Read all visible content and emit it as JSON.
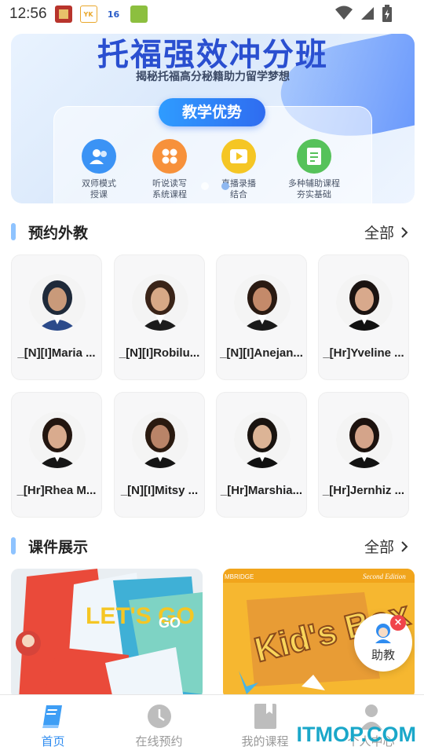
{
  "status_bar": {
    "time": "12:56",
    "app_icons": [
      {
        "name": "app-icon-1",
        "color": "#b8342c"
      },
      {
        "name": "app-icon-yk",
        "color": "#e9a72c",
        "text": "YK"
      },
      {
        "name": "app-icon-16",
        "color": "#2a5cc8",
        "text": "16"
      },
      {
        "name": "app-icon-4",
        "color": "#8cbf3f"
      }
    ]
  },
  "banner": {
    "title": "托福强效冲分班",
    "subtitle": "揭秘托福高分秘籍助力留学梦想",
    "pill": "教学优势",
    "features": [
      {
        "label": "双师模式\n授课",
        "icon": "users-icon",
        "color": "#3b93f5"
      },
      {
        "label": "听说读写\n系统课程",
        "icon": "grid-icon",
        "color": "#f7913b"
      },
      {
        "label": "直播录播\n结合",
        "icon": "play-icon",
        "color": "#f5c624"
      },
      {
        "label": "多种辅助课程\n夯实基础",
        "icon": "document-icon",
        "color": "#56c25a"
      }
    ]
  },
  "teachers_section": {
    "title": "预约外教",
    "more": "全部",
    "teachers": [
      {
        "name": "_[N][I]Maria ..."
      },
      {
        "name": "_[N][I]Robilu..."
      },
      {
        "name": "_[N][I]Anejan..."
      },
      {
        "name": "_[Hr]Yveline ..."
      },
      {
        "name": "_[Hr]Rhea M..."
      },
      {
        "name": "_[N][I]Mitsy ..."
      },
      {
        "name": "_[Hr]Marshia..."
      },
      {
        "name": "_[Hr]Jernhiz ..."
      }
    ]
  },
  "courseware_section": {
    "title": "课件展示",
    "more": "全部",
    "items": [
      {
        "title": "LET'S GO"
      },
      {
        "title": "Kid's Box",
        "edition": "Second Edition",
        "publisher": "MBRIDGE"
      }
    ]
  },
  "assistant": {
    "label": "助教",
    "badge": "×"
  },
  "bottom_nav": [
    {
      "label": "首页",
      "icon": "book-icon",
      "active": true
    },
    {
      "label": "在线预约",
      "icon": "clock-icon",
      "active": false
    },
    {
      "label": "我的课程",
      "icon": "bookmark-icon",
      "active": false
    },
    {
      "label": "个人中心",
      "icon": "user-icon",
      "active": false
    }
  ],
  "watermark": "ITMOP.COM",
  "colors": {
    "accent": "#2f8cf0",
    "section_bar": "#8ec3ff",
    "badge": "#f0444a"
  }
}
